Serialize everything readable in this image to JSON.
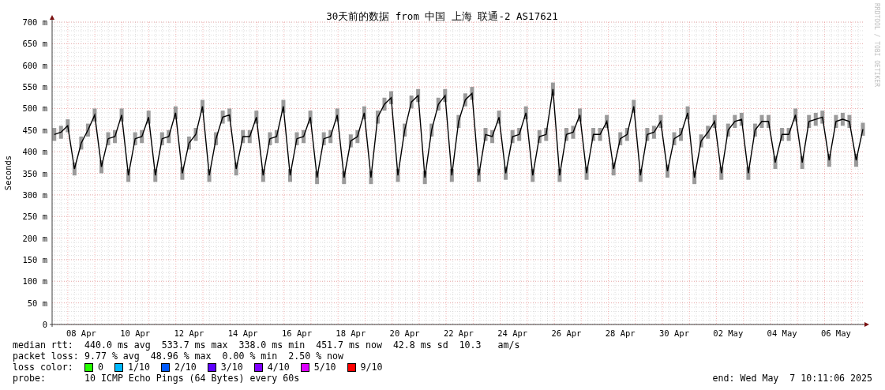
{
  "chart": {
    "chart_data": {
      "type": "line",
      "title": "30天前的数据 from 中国 上海 联通-2 AS17621",
      "ylabel": "Seconds",
      "categories": [
        null,
        null,
        null,
        null,
        "08 Apr",
        null,
        null,
        null,
        null,
        null,
        null,
        null,
        "10 Apr",
        null,
        null,
        null,
        null,
        null,
        null,
        null,
        "12 Apr",
        null,
        null,
        null,
        null,
        null,
        null,
        null,
        "14 Apr",
        null,
        null,
        null,
        null,
        null,
        null,
        null,
        "16 Apr",
        null,
        null,
        null,
        null,
        null,
        null,
        null,
        "18 Apr",
        null,
        null,
        null,
        null,
        null,
        null,
        null,
        "20 Apr",
        null,
        null,
        null,
        null,
        null,
        null,
        null,
        "22 Apr",
        null,
        null,
        null,
        null,
        null,
        null,
        null,
        "24 Apr",
        null,
        null,
        null,
        null,
        null,
        null,
        null,
        "26 Apr",
        null,
        null,
        null,
        null,
        null,
        null,
        null,
        "28 Apr",
        null,
        null,
        null,
        null,
        null,
        null,
        null,
        "30 Apr",
        null,
        null,
        null,
        null,
        null,
        null,
        null,
        "02 May",
        null,
        null,
        null,
        null,
        null,
        null,
        null,
        "04 May",
        null,
        null,
        null,
        null,
        null,
        null,
        null,
        "06 May",
        null,
        null,
        null,
        null
      ],
      "series": [
        {
          "color": "#000000",
          "errors": [
            15,
            15,
            15,
            15,
            15,
            15,
            15,
            15,
            15,
            15,
            15,
            15,
            15,
            15,
            15,
            15,
            15,
            15,
            15,
            15,
            15,
            15,
            15,
            15,
            15,
            15,
            15,
            15,
            15,
            15,
            15,
            15,
            15,
            15,
            15,
            15,
            15,
            15,
            15,
            15,
            15,
            15,
            15,
            15,
            15,
            15,
            15,
            15,
            15,
            15,
            15,
            15,
            15,
            15,
            15,
            15,
            15,
            15,
            15,
            15,
            15,
            15,
            15,
            15,
            15,
            15,
            15,
            15,
            15,
            15,
            15,
            15,
            15,
            15,
            15,
            15,
            15,
            15,
            15,
            15,
            15,
            15,
            15,
            15,
            15,
            15,
            15,
            15,
            15,
            15,
            15,
            15,
            15,
            15,
            15,
            15,
            15,
            15,
            15,
            15,
            15,
            15,
            15,
            15,
            15,
            15,
            15,
            15,
            15,
            15,
            15,
            15,
            15,
            15,
            15,
            15,
            15,
            15,
            15,
            15,
            15
          ],
          "values": [
            440,
            445,
            460,
            360,
            420,
            450,
            485,
            365,
            430,
            435,
            485,
            345,
            430,
            435,
            480,
            345,
            430,
            435,
            490,
            350,
            420,
            440,
            505,
            345,
            430,
            480,
            485,
            360,
            435,
            435,
            480,
            345,
            430,
            435,
            505,
            345,
            430,
            435,
            480,
            340,
            430,
            435,
            485,
            340,
            425,
            435,
            490,
            340,
            480,
            510,
            525,
            345,
            450,
            515,
            530,
            340,
            450,
            510,
            530,
            345,
            470,
            520,
            535,
            345,
            440,
            435,
            480,
            350,
            435,
            440,
            490,
            345,
            435,
            440,
            545,
            345,
            440,
            445,
            485,
            350,
            440,
            440,
            470,
            360,
            430,
            440,
            505,
            345,
            440,
            445,
            470,
            355,
            430,
            440,
            490,
            340,
            425,
            445,
            470,
            350,
            450,
            470,
            475,
            350,
            450,
            470,
            470,
            375,
            440,
            440,
            485,
            375,
            470,
            475,
            480,
            380,
            470,
            475,
            470,
            380,
            452
          ]
        }
      ],
      "ylim": [
        0,
        700
      ],
      "grid": true,
      "yticks": [
        {
          "value": 0,
          "label": "0"
        },
        {
          "value": 50,
          "label": "50 m"
        },
        {
          "value": 100,
          "label": "100 m"
        },
        {
          "value": 150,
          "label": "150 m"
        },
        {
          "value": 200,
          "label": "200 m"
        },
        {
          "value": 250,
          "label": "250 m"
        },
        {
          "value": 300,
          "label": "300 m"
        },
        {
          "value": 350,
          "label": "350 m"
        },
        {
          "value": 400,
          "label": "400 m"
        },
        {
          "value": 450,
          "label": "450 m"
        },
        {
          "value": 500,
          "label": "500 m"
        },
        {
          "value": 550,
          "label": "550 m"
        },
        {
          "value": 600,
          "label": "600 m"
        },
        {
          "value": 650,
          "label": "650 m"
        },
        {
          "value": 700,
          "label": "700 m"
        }
      ]
    },
    "credit": "RRDTOOL / TOBI OETIKER"
  },
  "legend": {
    "median_rtt": {
      "label": "median rtt:",
      "value": "440.0 ms avg  533.7 ms max  338.0 ms min  451.7 ms now  42.8 ms sd  10.3   am/s"
    },
    "packet_loss": {
      "label": "packet loss:",
      "value": "9.77 % avg  48.96 % max  0.00 % min  2.50 % now"
    },
    "loss_color": {
      "label": "loss color:",
      "items": [
        {
          "label": "0",
          "color": "#26ff00"
        },
        {
          "label": "1/10",
          "color": "#00b8ff"
        },
        {
          "label": "2/10",
          "color": "#0059ff"
        },
        {
          "label": "3/10",
          "color": "#5e00ff"
        },
        {
          "label": "4/10",
          "color": "#7e00ff"
        },
        {
          "label": "5/10",
          "color": "#dd00ff"
        },
        {
          "label": "9/10",
          "color": "#ff0000"
        }
      ]
    },
    "probe": {
      "label": "probe:",
      "value": "10 ICMP Echo Pings (64 Bytes) every 60s"
    },
    "end": "end: Wed May  7 10:11:06 2025"
  }
}
